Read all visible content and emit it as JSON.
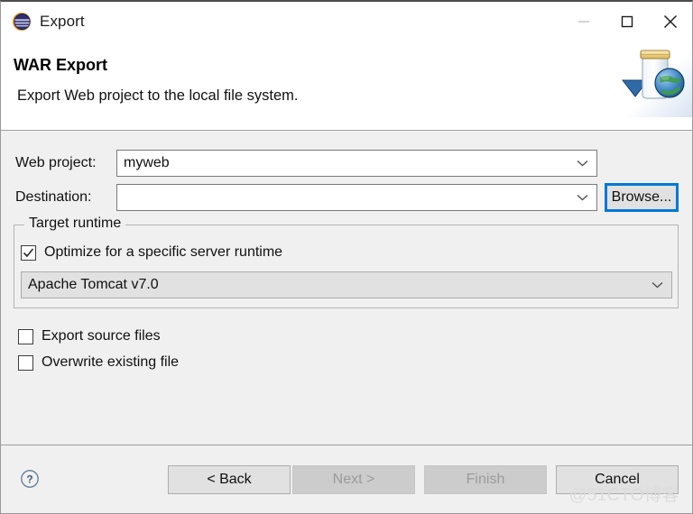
{
  "window": {
    "title": "Export",
    "app_icon": "eclipse-logo-icon",
    "controls": {
      "minimize": "minimize-icon",
      "maximize": "maximize-icon",
      "close": "close-icon"
    }
  },
  "header": {
    "title": "WAR Export",
    "description": "Export Web project to the local file system.",
    "banner_icon": "war-jar-globe-icon"
  },
  "form": {
    "web_project": {
      "label": "Web project:",
      "value": "myweb",
      "placeholder": ""
    },
    "destination": {
      "label": "Destination:",
      "value": "",
      "placeholder": ""
    },
    "browse_button": "Browse..."
  },
  "target_runtime": {
    "legend": "Target runtime",
    "optimize_checkbox": {
      "label": "Optimize for a specific server runtime",
      "checked": true
    },
    "runtime_combo": {
      "value": "Apache Tomcat v7.0"
    }
  },
  "options": {
    "export_source_files": {
      "label": "Export source files",
      "checked": false
    },
    "overwrite_existing_file": {
      "label": "Overwrite existing file",
      "checked": false
    }
  },
  "footer": {
    "help_icon": "help-question-icon",
    "buttons": {
      "back": "< Back",
      "next": "Next >",
      "finish": "Finish",
      "cancel": "Cancel"
    }
  },
  "watermark": "@51CTO博客",
  "colors": {
    "accent_focus": "#0078D7",
    "dialog_bg": "#F0F0F0",
    "titlebar_bg": "#FFFFFF",
    "button_bg": "#E1E1E1",
    "button_disabled_bg": "#CCCCCC",
    "disabled_text": "#9B9B9B"
  }
}
